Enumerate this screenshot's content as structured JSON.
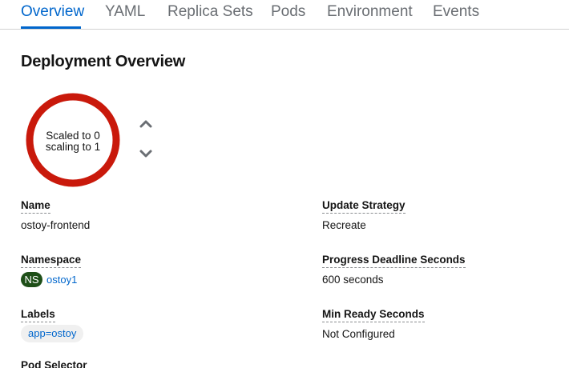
{
  "tabs": [
    {
      "label": "Overview",
      "active": true
    },
    {
      "label": "YAML"
    },
    {
      "label": "Replica Sets"
    },
    {
      "label": "Pods"
    },
    {
      "label": "Environment"
    },
    {
      "label": "Events"
    }
  ],
  "page_title": "Deployment Overview",
  "pod_ring": {
    "line1": "Scaled to 0",
    "line2": "scaling to 1",
    "ring_color": "#c9190b",
    "current_pods": 0,
    "desired_pods": 1
  },
  "scale_controls": {
    "up_icon": "chevron-up-icon",
    "down_icon": "chevron-down-icon"
  },
  "details": {
    "name_label": "Name",
    "name_value": "ostoy-frontend",
    "namespace_label": "Namespace",
    "namespace_badge": "NS",
    "namespace_value": "ostoy1",
    "labels_label": "Labels",
    "labels": [
      "app=ostoy"
    ],
    "pod_selector_label": "Pod Selector",
    "update_strategy_label": "Update Strategy",
    "update_strategy_value": "Recreate",
    "progress_deadline_label": "Progress Deadline Seconds",
    "progress_deadline_value": "600 seconds",
    "min_ready_label": "Min Ready Seconds",
    "min_ready_value": "Not Configured"
  },
  "colors": {
    "link": "#0066cc",
    "ns_badge": "#1e4f18",
    "ring": "#c9190b"
  }
}
